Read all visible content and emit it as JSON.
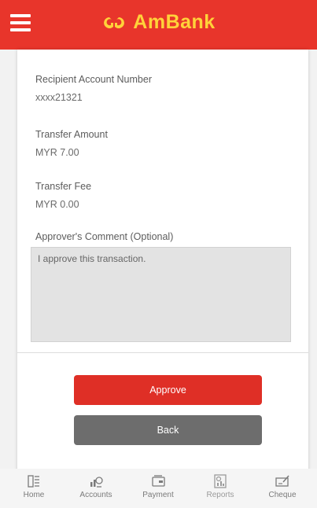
{
  "header": {
    "brand": "AmBank",
    "colors": {
      "bar": "#e8352b",
      "logo": "#ffd23a"
    }
  },
  "details": {
    "recipient_label": "Recipient Account Number",
    "recipient_value": "xxxx21321",
    "amount_label": "Transfer Amount",
    "amount_value": "MYR 7.00",
    "fee_label": "Transfer Fee",
    "fee_value": "MYR 0.00",
    "comment_label": "Approver's Comment (Optional)",
    "comment_value": "I approve this transaction."
  },
  "actions": {
    "approve_label": "Approve",
    "back_label": "Back",
    "colors": {
      "approve": "#df2f26",
      "back": "#6d6d6d"
    }
  },
  "nav": {
    "items": [
      {
        "label": "Home",
        "icon": "home-icon"
      },
      {
        "label": "Accounts",
        "icon": "accounts-icon"
      },
      {
        "label": "Payment",
        "icon": "wallet-icon"
      },
      {
        "label": "Reports",
        "icon": "reports-icon"
      },
      {
        "label": "Cheque",
        "icon": "cheque-icon"
      }
    ]
  }
}
